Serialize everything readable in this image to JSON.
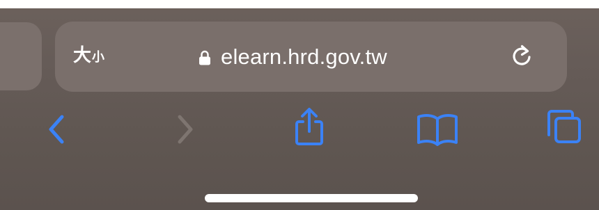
{
  "address_bar": {
    "text_size_label_large": "大",
    "text_size_label_small": "小",
    "url": "elearn.hrd.gov.tw"
  },
  "icons": {
    "lock": "lock-icon",
    "reload": "reload-icon",
    "back": "chevron-left-icon",
    "forward": "chevron-right-icon",
    "share": "share-icon",
    "bookmarks": "book-icon",
    "tabs": "tabs-icon"
  },
  "toolbar": {
    "back_enabled": true,
    "forward_enabled": false
  },
  "colors": {
    "accent": "#3b82f6",
    "disabled": "#7e7570",
    "text": "#ffffff"
  }
}
